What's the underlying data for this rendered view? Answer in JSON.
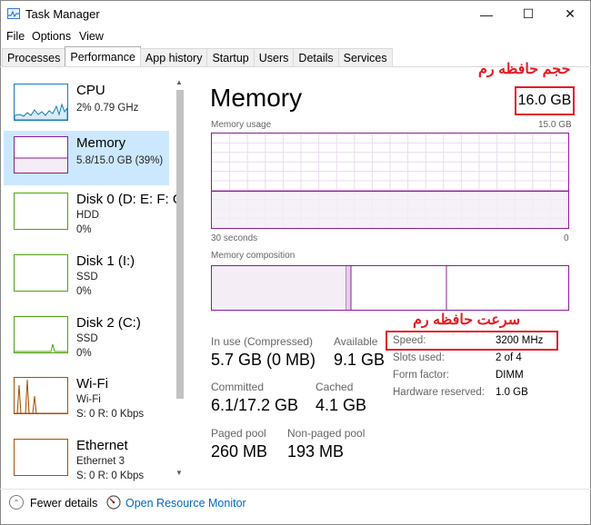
{
  "window": {
    "title": "Task Manager",
    "minimize_glyph": "—",
    "maximize_glyph": "☐",
    "close_glyph": "✕"
  },
  "menu": [
    "File",
    "Options",
    "View"
  ],
  "tabs": [
    "Processes",
    "Performance",
    "App history",
    "Startup",
    "Users",
    "Details",
    "Services"
  ],
  "active_tab": "Performance",
  "sidebar": {
    "items": [
      {
        "title": "CPU",
        "lines": [
          "2%  0.79 GHz"
        ]
      },
      {
        "title": "Memory",
        "lines": [
          "5.8/15.0 GB (39%)"
        ]
      },
      {
        "title": "Disk 0 (D: E: F: G",
        "lines": [
          "HDD",
          "0%"
        ]
      },
      {
        "title": "Disk 1 (I:)",
        "lines": [
          "SSD",
          "0%"
        ]
      },
      {
        "title": "Disk 2 (C:)",
        "lines": [
          "SSD",
          "0%"
        ]
      },
      {
        "title": "Wi-Fi",
        "lines": [
          "Wi-Fi",
          "S: 0  R: 0 Kbps"
        ]
      },
      {
        "title": "Ethernet",
        "lines": [
          "Ethernet 3",
          "S: 0  R: 0 Kbps"
        ]
      }
    ],
    "selected": "Memory"
  },
  "main": {
    "title": "Memory",
    "total": "16.0 GB",
    "annotation_total": "حجم حافظه رم",
    "annotation_speed": "سرعت حافظه رم",
    "usage_label": "Memory usage",
    "usage_max": "15.0 GB",
    "time_left": "30 seconds",
    "time_right": "0",
    "composition_label": "Memory composition",
    "usage_level": 0.39,
    "stats": {
      "in_use_label": "In use (Compressed)",
      "in_use_value": "5.7 GB (0 MB)",
      "available_label": "Available",
      "available_value": "9.1 GB",
      "committed_label": "Committed",
      "committed_value": "6.1/17.2 GB",
      "cached_label": "Cached",
      "cached_value": "4.1 GB",
      "paged_label": "Paged pool",
      "paged_value": "260 MB",
      "nonpaged_label": "Non-paged pool",
      "nonpaged_value": "193 MB"
    },
    "details": [
      {
        "label": "Speed:",
        "value": "3200 MHz"
      },
      {
        "label": "Slots used:",
        "value": "2 of 4"
      },
      {
        "label": "Form factor:",
        "value": "DIMM"
      },
      {
        "label": "Hardware reserved:",
        "value": "1.0 GB"
      }
    ]
  },
  "footer": {
    "fewer_details": "Fewer details",
    "open_monitor": "Open Resource Monitor"
  },
  "colors": {
    "memory_accent": "#8b1c97",
    "memory_fill": "#f4edf6",
    "cpu_accent": "#117dbb",
    "disk_accent": "#4da60c",
    "network_accent": "#a74f01",
    "annotation": "#e51c23",
    "selected_bg": "#cce8ff"
  }
}
